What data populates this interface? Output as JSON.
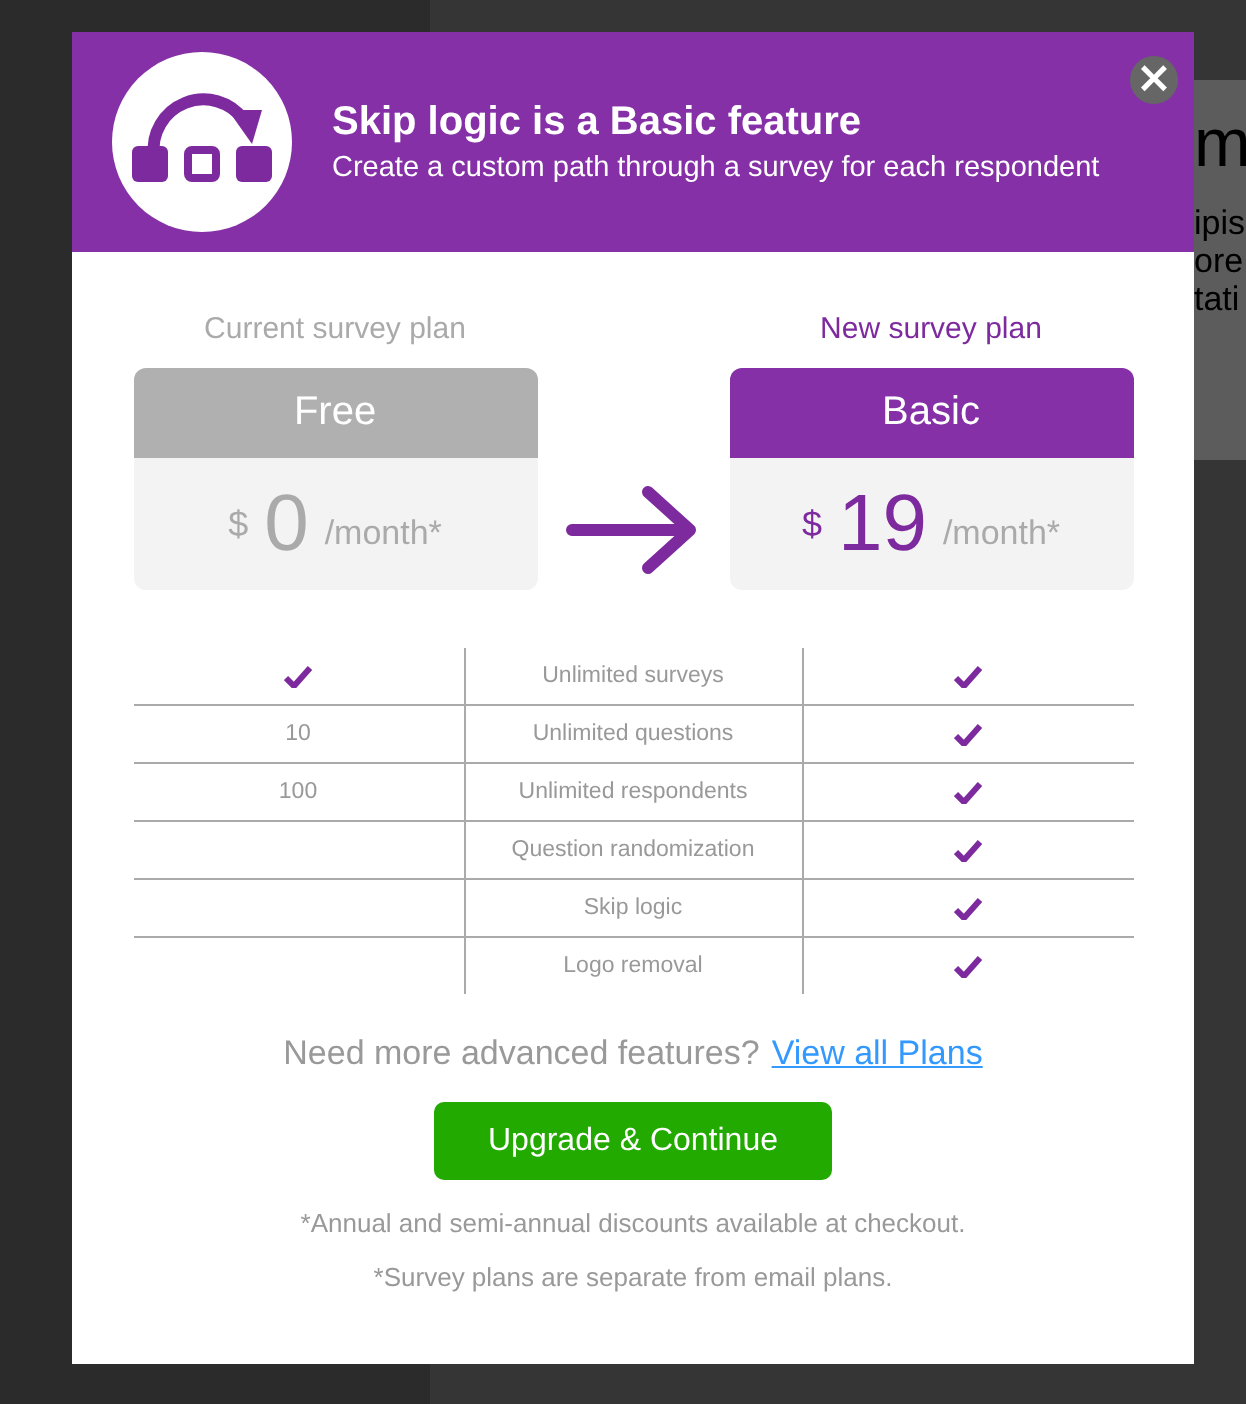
{
  "backdrop": {
    "fragments": [
      "m",
      "ipis",
      "ore",
      "tati"
    ]
  },
  "modal": {
    "title": "Skip logic is a Basic feature",
    "subtitle": "Create a custom path through a survey for each respondent",
    "close": "×"
  },
  "plans": [
    {
      "kind": "current",
      "caption": "Current survey plan",
      "name": "Free",
      "currency": "$",
      "price": "0",
      "period": "/month*"
    },
    {
      "kind": "new",
      "caption": "New survey plan",
      "name": "Basic",
      "currency": "$",
      "price": "19",
      "period": "/month*"
    }
  ],
  "features": [
    {
      "current": {
        "kind": "check"
      },
      "feature": "Unlimited surveys",
      "new": {
        "kind": "check"
      }
    },
    {
      "current": {
        "kind": "text",
        "text": "10"
      },
      "feature": "Unlimited questions",
      "new": {
        "kind": "check"
      }
    },
    {
      "current": {
        "kind": "text",
        "text": "100"
      },
      "feature": "Unlimited respondents",
      "new": {
        "kind": "check"
      }
    },
    {
      "current": {
        "kind": "none"
      },
      "feature": "Question randomization",
      "new": {
        "kind": "check"
      }
    },
    {
      "current": {
        "kind": "none"
      },
      "feature": "Skip logic",
      "new": {
        "kind": "check"
      }
    },
    {
      "current": {
        "kind": "none"
      },
      "feature": "Logo removal",
      "new": {
        "kind": "check"
      }
    }
  ],
  "more": {
    "text": "Need more advanced features?",
    "link": "View all Plans"
  },
  "upgrade_button": "Upgrade & Continue",
  "footnotes": [
    "*Annual and semi-annual discounts available at checkout.",
    "*Survey plans are separate from email plans."
  ]
}
